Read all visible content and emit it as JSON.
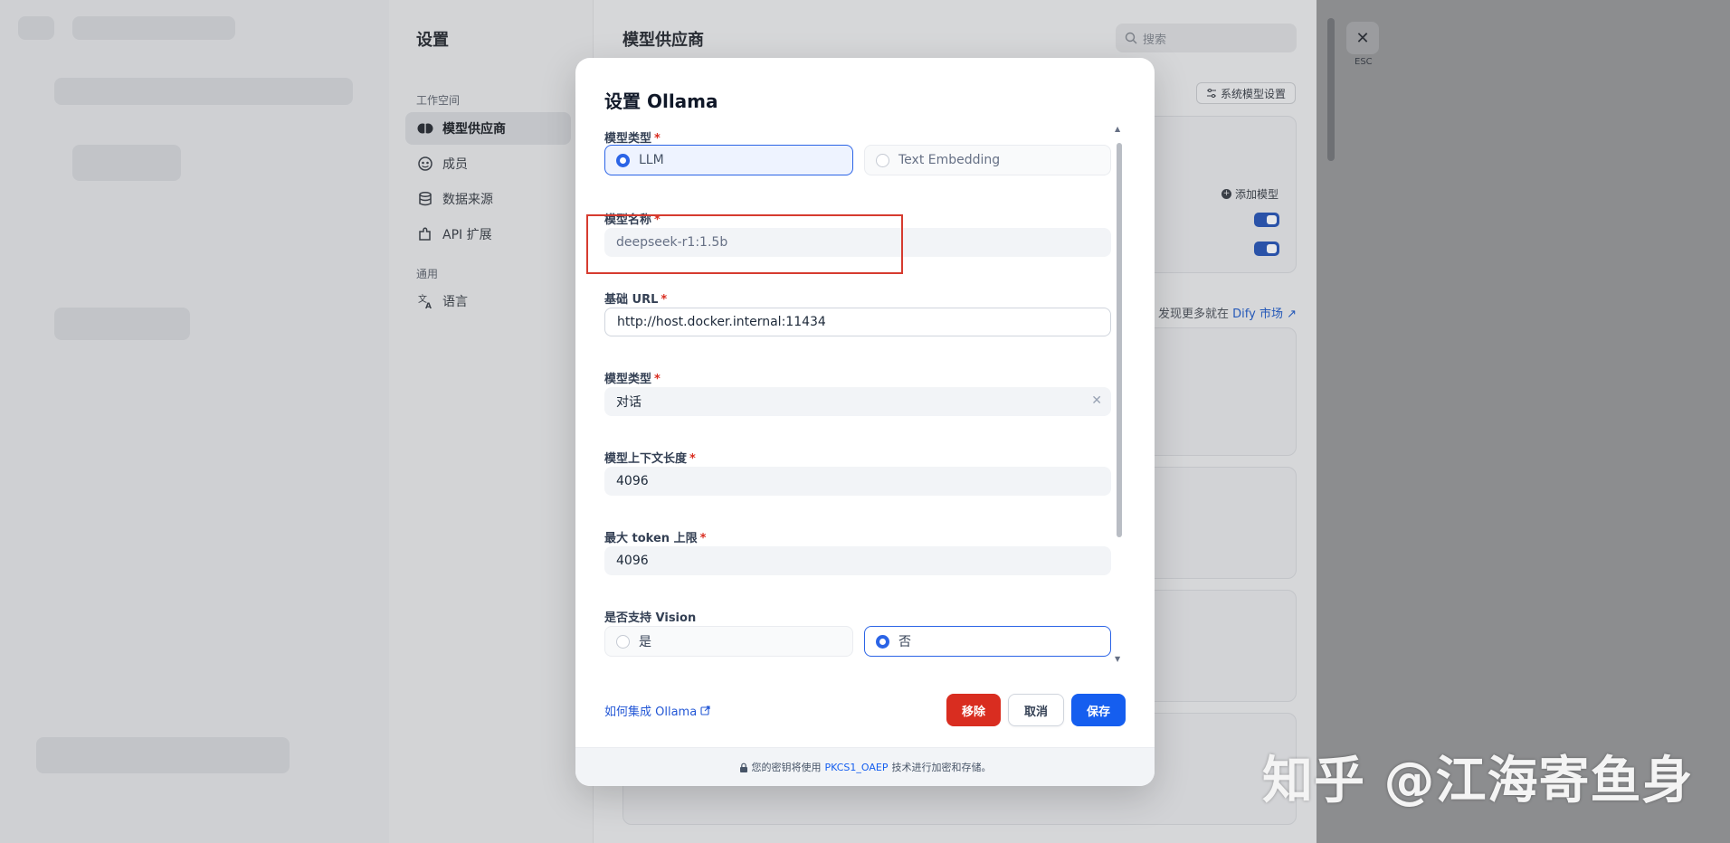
{
  "settings": {
    "title": "设置",
    "workspace_group": "工作空间",
    "general_group": "通用",
    "nav": [
      {
        "label": "模型供应商",
        "icon": "brain-icon",
        "active": true
      },
      {
        "label": "成员",
        "icon": "members-icon",
        "active": false
      },
      {
        "label": "数据来源",
        "icon": "database-icon",
        "active": false
      },
      {
        "label": "API 扩展",
        "icon": "puzzle-icon",
        "active": false
      }
    ],
    "language": {
      "label": "语言",
      "icon": "translate-icon"
    }
  },
  "content": {
    "title": "模型供应商",
    "search_placeholder": "搜索",
    "system_model_settings": "系统模型设置",
    "add_model": "添加模型",
    "market_prefix": "发现更多就在",
    "market_link": "Dify 市场 ↗"
  },
  "close": {
    "label": "ESC"
  },
  "modal": {
    "title": "设置 Ollama",
    "model_type": {
      "label": "模型类型",
      "options": [
        "LLM",
        "Text Embedding"
      ],
      "selected": "LLM"
    },
    "model_name": {
      "label": "模型名称",
      "value": "deepseek-r1:1.5b"
    },
    "base_url": {
      "label": "基础 URL",
      "value": "http://host.docker.internal:11434"
    },
    "completion_type": {
      "label": "模型类型",
      "value": "对话"
    },
    "context_length": {
      "label": "模型上下文长度",
      "value": "4096"
    },
    "max_tokens": {
      "label": "最大 token 上限",
      "value": "4096"
    },
    "vision": {
      "label": "是否支持 Vision",
      "options": [
        "是",
        "否"
      ],
      "selected": "否"
    },
    "help_link": "如何集成 Ollama",
    "buttons": {
      "remove": "移除",
      "cancel": "取消",
      "save": "保存"
    },
    "footer": {
      "prefix": "您的密钥将使用",
      "link": "PKCS1_OAEP",
      "suffix": "技术进行加密和存储。"
    }
  },
  "watermark": "知乎 @江海寄鱼身",
  "colors": {
    "primary": "#155eef",
    "danger": "#d92d20",
    "highlight": "#d63b2f"
  }
}
